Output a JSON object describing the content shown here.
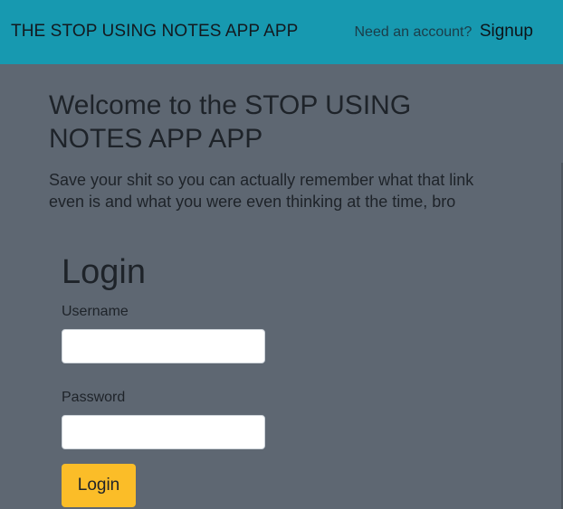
{
  "navbar": {
    "brand": "THE STOP USING NOTES APP APP",
    "account_prompt": "Need an account?",
    "signup_label": "Signup"
  },
  "welcome": {
    "title": "Welcome to the STOP USING NOTES APP APP",
    "tagline": "Save your shit so you can actually remember what that link even is and what you were even thinking at the time, bro"
  },
  "login": {
    "title": "Login",
    "username_label": "Username",
    "username_value": "",
    "password_label": "Password",
    "password_value": "",
    "submit_label": "Login"
  },
  "colors": {
    "navbar_bg": "#1799b0",
    "page_bg": "#5e6772",
    "button_bg": "#fbbd28"
  }
}
